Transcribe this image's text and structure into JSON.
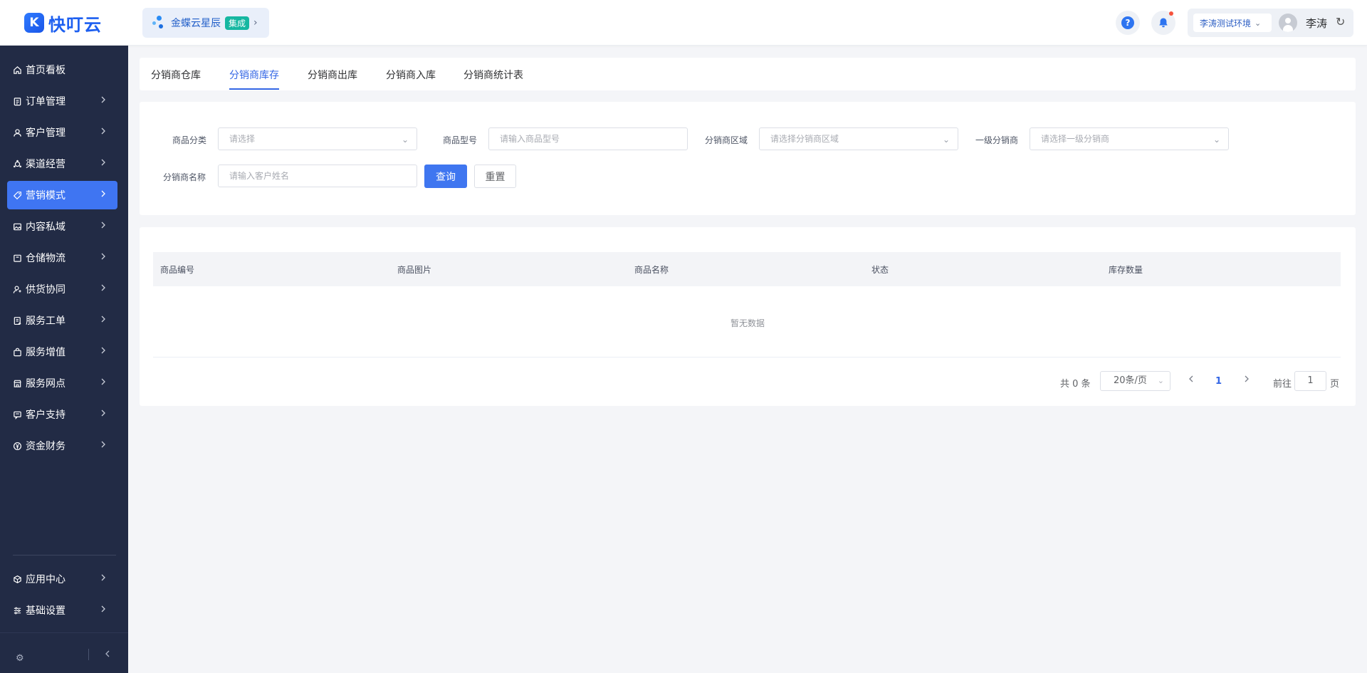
{
  "header": {
    "logo_mark": "K",
    "logo_text": "快叮云",
    "app_name": "金蝶云星辰",
    "app_badge": "集成",
    "help_icon": "?",
    "environment": "李涛测试环境",
    "user_name": "李涛"
  },
  "sidebar": {
    "items": [
      {
        "label": "首页看板",
        "icon": "home-icon"
      },
      {
        "label": "订单管理",
        "icon": "clipboard-icon"
      },
      {
        "label": "客户管理",
        "icon": "user-icon"
      },
      {
        "label": "渠道经营",
        "icon": "channel-icon"
      },
      {
        "label": "营销模式",
        "icon": "tag-icon"
      },
      {
        "label": "内容私域",
        "icon": "image-icon"
      },
      {
        "label": "仓储物流",
        "icon": "box-icon"
      },
      {
        "label": "供货协同",
        "icon": "supplier-icon"
      },
      {
        "label": "服务工单",
        "icon": "ticket-icon"
      },
      {
        "label": "服务增值",
        "icon": "bag-icon"
      },
      {
        "label": "服务网点",
        "icon": "store-icon"
      },
      {
        "label": "客户支持",
        "icon": "support-icon"
      },
      {
        "label": "资金财务",
        "icon": "yen-icon"
      }
    ],
    "bottom_items": [
      {
        "label": "应用中心",
        "icon": "cube-icon"
      },
      {
        "label": "基础设置",
        "icon": "sliders-icon"
      }
    ]
  },
  "tabs": [
    "分销商仓库",
    "分销商库存",
    "分销商出库",
    "分销商入库",
    "分销商统计表"
  ],
  "filters": {
    "category_label": "商品分类",
    "category_placeholder": "请选择",
    "model_label": "商品型号",
    "model_placeholder": "请输入商品型号",
    "region_label": "分销商区域",
    "region_placeholder": "请选择分销商区域",
    "level1_label": "一级分销商",
    "level1_placeholder": "请选择一级分销商",
    "name_label": "分销商名称",
    "name_placeholder": "请输入客户姓名",
    "query_button": "查询",
    "reset_button": "重置"
  },
  "table": {
    "columns": [
      "商品编号",
      "商品图片",
      "商品名称",
      "状态",
      "库存数量"
    ],
    "rows": [],
    "empty_text": "暂无数据"
  },
  "pagination": {
    "total": "共 0 条",
    "page_size": "20条/页",
    "current_page": "1",
    "goto_label": "前往",
    "goto_value": "1",
    "page_suffix": "页"
  },
  "colors": {
    "sidebar_bg": "#222b45",
    "accent": "#3f75f2",
    "active_tab": "#3366e5"
  }
}
